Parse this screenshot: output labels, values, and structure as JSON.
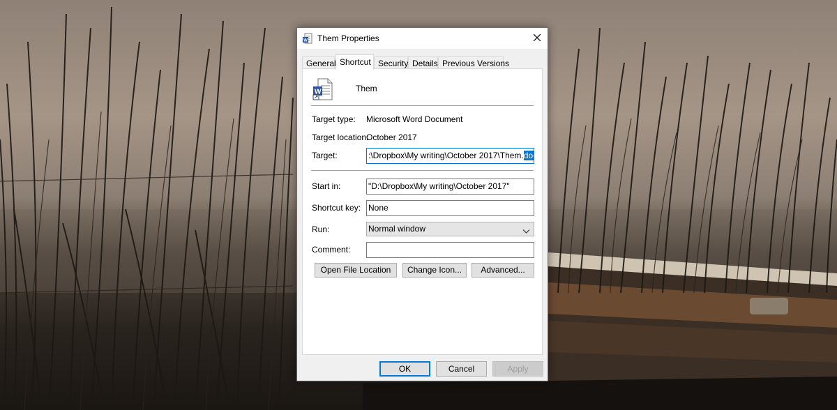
{
  "dialog": {
    "title": "Them Properties",
    "title_icon": "word-document-icon",
    "close_icon": "close-icon"
  },
  "tabs": [
    {
      "label": "General",
      "active": false
    },
    {
      "label": "Shortcut",
      "active": true
    },
    {
      "label": "Security",
      "active": false
    },
    {
      "label": "Details",
      "active": false
    },
    {
      "label": "Previous Versions",
      "active": false
    }
  ],
  "file": {
    "name": "Them",
    "icon": "word-shortcut-icon"
  },
  "properties": {
    "target_type_label": "Target type:",
    "target_type_value": "Microsoft Word Document",
    "target_location_label": "Target location:",
    "target_location_value": "October 2017",
    "target_label": "Target:",
    "target_value_prefix": ":\\Dropbox\\My writing\\October 2017\\Them.",
    "target_value_selected": "docx",
    "target_value_suffix": "\"",
    "start_in_label": "Start in:",
    "start_in_value": "\"D:\\Dropbox\\My writing\\October 2017\"",
    "shortcut_key_label": "Shortcut key:",
    "shortcut_key_value": "None",
    "run_label": "Run:",
    "run_value": "Normal window",
    "comment_label": "Comment:",
    "comment_value": ""
  },
  "actions": {
    "open_file_location": "Open File Location",
    "change_icon": "Change Icon...",
    "advanced": "Advanced..."
  },
  "footer": {
    "ok": "OK",
    "cancel": "Cancel",
    "apply": "Apply",
    "apply_enabled": false
  },
  "colors": {
    "accent": "#0078d7",
    "selection_text": "#ffffff",
    "button_face": "#e1e1e1"
  }
}
